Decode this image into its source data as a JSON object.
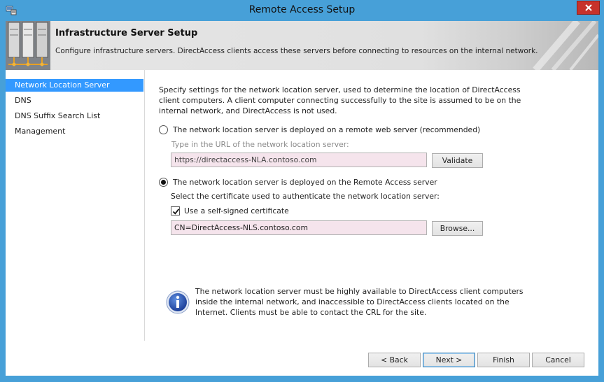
{
  "window": {
    "title": "Remote Access Setup",
    "icon": "remote-access-setup-icon",
    "accent_color": "#47a0d8",
    "close_color": "#c7322b"
  },
  "header": {
    "title": "Infrastructure Server Setup",
    "description": "Configure infrastructure servers. DirectAccess clients access these servers before connecting to resources on the internal network.",
    "icon": "server-rack-icon"
  },
  "nav": {
    "items": [
      {
        "label": "Network Location Server",
        "selected": true
      },
      {
        "label": "DNS",
        "selected": false
      },
      {
        "label": "DNS Suffix Search List",
        "selected": false
      },
      {
        "label": "Management",
        "selected": false
      }
    ],
    "selected_color": "#3399ff"
  },
  "main": {
    "intro": "Specify settings for the network location server, used to determine the location of DirectAccess client computers. A client computer connecting successfully to the site is assumed to be on the internal network, and DirectAccess is not used.",
    "option_remote": {
      "label": "The network location server is deployed on a remote web server (recommended)",
      "checked": false,
      "url_prompt": "Type in the URL of the network location server:",
      "url_value": "https://directaccess-NLA.contoso.com",
      "validate_label": "Validate"
    },
    "option_local": {
      "label": "The network location server is deployed on the Remote Access server",
      "checked": true,
      "cert_prompt": "Select the certificate used to authenticate the network location server:",
      "self_signed_label": "Use a self-signed certificate",
      "self_signed_checked": true,
      "cert_value": "CN=DirectAccess-NLS.contoso.com",
      "browse_label": "Browse..."
    },
    "info": {
      "icon": "info-icon",
      "text": "The network location server must be highly available to DirectAccess client computers inside the internal network, and inaccessible to DirectAccess clients located on the Internet. Clients must be able to contact the CRL for the site."
    }
  },
  "footer": {
    "back_label": "< Back",
    "next_label": "Next >",
    "finish_label": "Finish",
    "cancel_label": "Cancel"
  }
}
